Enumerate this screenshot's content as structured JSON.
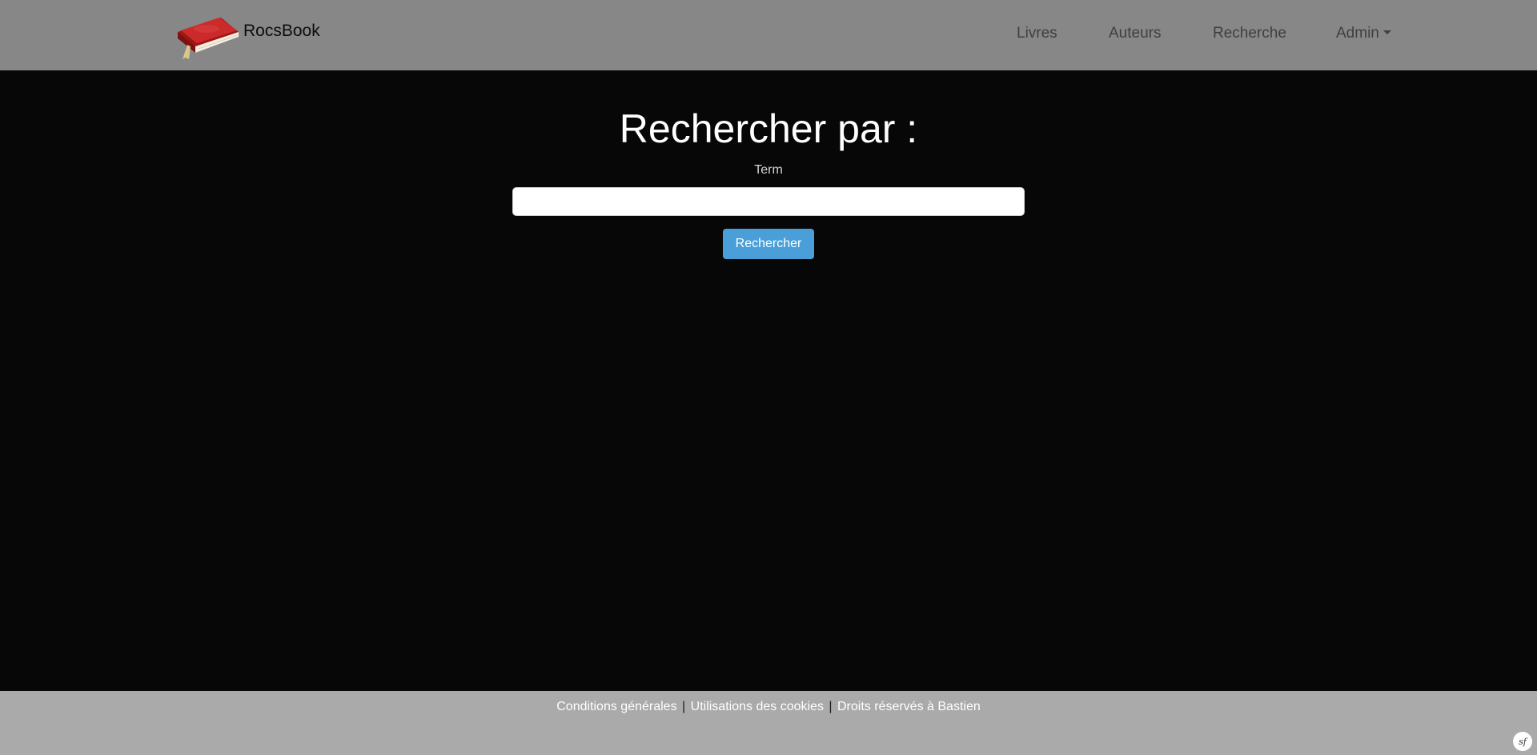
{
  "navbar": {
    "brand": "RocsBook",
    "links": [
      {
        "label": "Livres"
      },
      {
        "label": "Auteurs"
      },
      {
        "label": "Recherche"
      },
      {
        "label": "Admin"
      }
    ]
  },
  "search": {
    "title": "Rechercher par :",
    "term_label": "Term",
    "term_value": "",
    "button_label": "Rechercher"
  },
  "footer": {
    "links": [
      {
        "label": "Conditions générales"
      },
      {
        "label": "Utilisations des cookies"
      },
      {
        "label": "Droits réservés à Bastien"
      }
    ],
    "separator": "|"
  },
  "debug_toolbar": {
    "icon": "symfony-icon",
    "label": "sf"
  },
  "colors": {
    "navbar_bg": "#878787",
    "page_bg": "#070707",
    "button_bg": "#4a9fd8",
    "footer_bg": "#a9aaa9"
  }
}
